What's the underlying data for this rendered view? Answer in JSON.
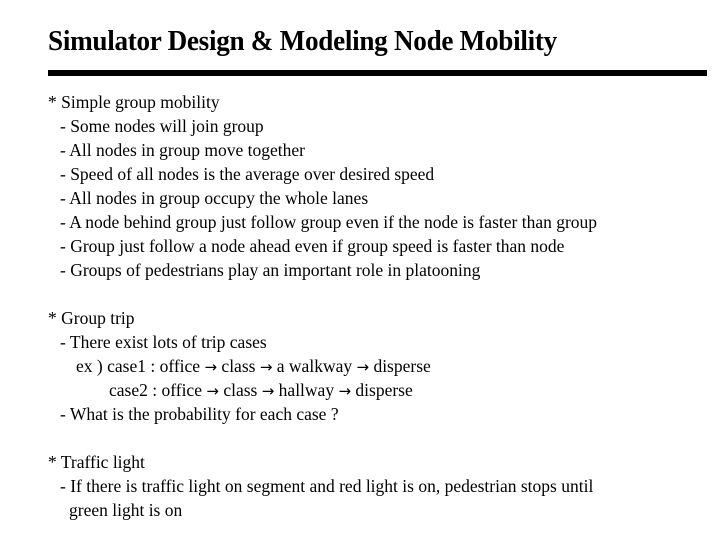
{
  "title": "Simulator Design & Modeling Node Mobility",
  "sections": [
    {
      "heading": "* Simple group mobility",
      "items": [
        "- Some nodes will join group",
        "- All nodes in group move together",
        "- Speed of all nodes is the average over desired speed",
        "- All nodes in group occupy the whole lanes",
        "- A node behind group just follow group even if the node is faster than group",
        "- Group just follow a node ahead even if group speed is faster than node",
        "- Groups of pedestrians play an important role in platooning"
      ]
    },
    {
      "heading": "* Group trip",
      "items": [
        "- There exist lots of trip cases"
      ],
      "cases": [
        {
          "prefix": "ex ) ",
          "label": "case1 : ",
          "steps": [
            "office",
            "class",
            "a walkway",
            "disperse"
          ]
        },
        {
          "prefix": "",
          "label": "case2 : ",
          "steps": [
            "office",
            "class",
            "hallway",
            "disperse"
          ]
        }
      ],
      "question": "- What is the probability for each case ?"
    },
    {
      "heading": "* Traffic light",
      "items": [
        "- If there is traffic light on segment and red light is on, pedestrian stops until",
        "green light is on"
      ]
    }
  ],
  "arrow_glyph": "→"
}
